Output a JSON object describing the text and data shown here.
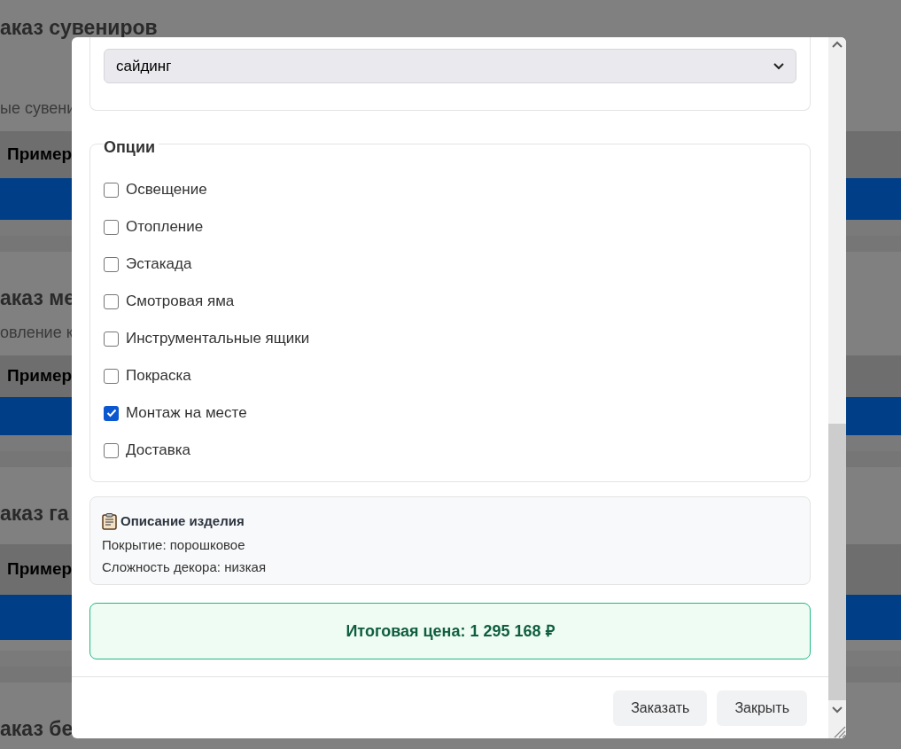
{
  "background_cards": [
    {
      "title": "аказ сувениров",
      "subtitle": "ые сувени",
      "header": "Пример"
    },
    {
      "title": "аказ ме",
      "subtitle": "овление к",
      "header": "Пример"
    },
    {
      "title": "аказ га",
      "header": "Пример"
    },
    {
      "title": "аказ бе"
    }
  ],
  "modal": {
    "cladding_select": {
      "value": "сайдинг"
    },
    "options": {
      "legend": "Опции",
      "items": [
        {
          "label": "Освещение",
          "checked": false
        },
        {
          "label": "Отопление",
          "checked": false
        },
        {
          "label": "Эстакада",
          "checked": false
        },
        {
          "label": "Смотровая яма",
          "checked": false
        },
        {
          "label": "Инструментальные ящики",
          "checked": false
        },
        {
          "label": "Покраска",
          "checked": false
        },
        {
          "label": "Монтаж на месте",
          "checked": true
        },
        {
          "label": "Доставка",
          "checked": false
        }
      ]
    },
    "description": {
      "title": "Описание изделия",
      "lines": [
        "Покрытие: порошковое",
        "Сложность декора: низкая"
      ]
    },
    "total": "Итоговая цена: 1 295 168 ₽",
    "buttons": [
      "Заказать",
      "Закрыть"
    ]
  }
}
